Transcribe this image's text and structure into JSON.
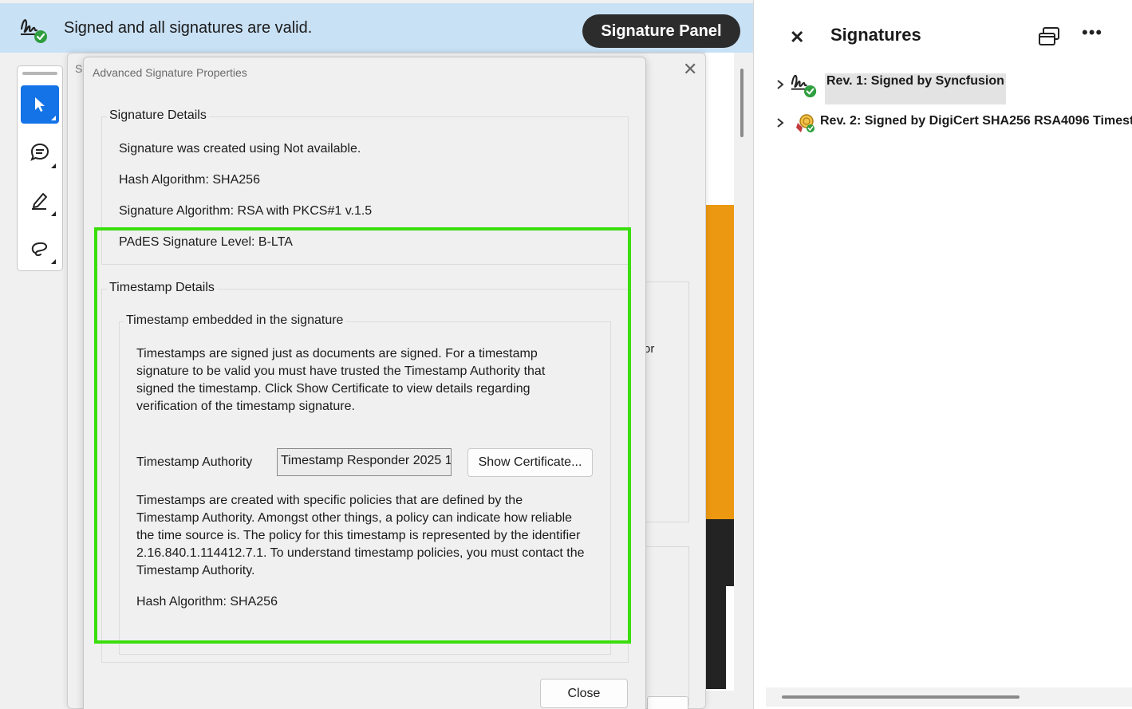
{
  "notice_bar": {
    "text": "Signed and all signatures are valid.",
    "panel_button": "Signature Panel",
    "icon": "signature-valid-icon"
  },
  "tools": [
    {
      "name": "select-tool",
      "icon": "cursor-icon",
      "active": true
    },
    {
      "name": "comment-tool",
      "icon": "comment-icon",
      "active": false
    },
    {
      "name": "highlight-tool",
      "icon": "pen-icon",
      "active": false
    },
    {
      "name": "draw-tool",
      "icon": "lasso-icon",
      "active": false
    }
  ],
  "behind_dialog": {
    "title_fragment": "Si",
    "side_text": "or"
  },
  "advanced_dialog": {
    "title": "Advanced Signature Properties",
    "signature_details": {
      "legend": "Signature Details",
      "created_using": "Signature was created using Not available.",
      "hash_algorithm": "Hash Algorithm: SHA256",
      "signature_algorithm": "Signature Algorithm: RSA with PKCS#1 v.1.5",
      "pades_level": "PAdES Signature Level: B-LTA"
    },
    "timestamp_details": {
      "legend": "Timestamp Details",
      "inner_legend": "Timestamp embedded in the signature",
      "para1": [
        "Timestamps are signed just as documents are signed. For a timestamp",
        "signature to be valid you must have trusted the Timestamp Authority that",
        "signed the timestamp. Click Show Certificate to view details regarding",
        "verification of the timestamp signature."
      ],
      "authority_label": "Timestamp Authority",
      "authority_value": "Timestamp Responder 2025 1",
      "show_certificate": "Show Certificate...",
      "para2": [
        "Timestamps are created with specific policies that are defined by the",
        "Timestamp Authority. Amongst other things, a policy can indicate how reliable",
        "the time source is. The policy for this timestamp is represented by the identifier",
        "2.16.840.1.114412.7.1. To understand timestamp policies, you must contact the",
        "Timestamp Authority."
      ],
      "hash_algorithm": "Hash Algorithm: SHA256"
    },
    "close_button": "Close"
  },
  "signatures_panel": {
    "title": "Signatures",
    "items": [
      {
        "label": "Rev. 1: Signed by Syncfusion",
        "icon": "signature-valid-icon"
      },
      {
        "label": "Rev. 2: Signed by DigiCert SHA256 RSA4096 Timest",
        "icon": "timestamp-seal-icon"
      }
    ]
  },
  "colors": {
    "notice_bg": "#c9e1f5",
    "accent": "#1473e6",
    "highlight": "#3ade0c",
    "orange": "#ec9810",
    "valid_green": "#2e9e3e"
  }
}
